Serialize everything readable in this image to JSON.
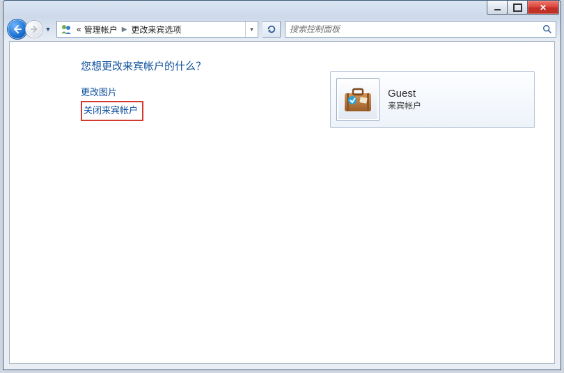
{
  "breadcrumb": {
    "prefix": "«",
    "seg1": "管理帐户",
    "seg2": "更改来宾选项"
  },
  "search": {
    "placeholder": "搜索控制面板"
  },
  "heading": "您想更改来宾帐户的什么？",
  "links": {
    "change_picture": "更改图片",
    "turn_off_guest": "关闭来宾帐户"
  },
  "account": {
    "name": "Guest",
    "type": "来宾帐户"
  }
}
